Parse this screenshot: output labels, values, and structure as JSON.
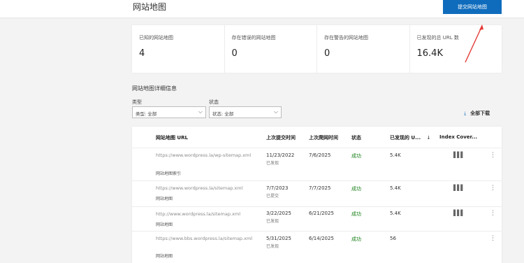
{
  "header": {
    "title": "网站地图",
    "submit_button": "提交网站地图"
  },
  "stats": [
    {
      "label": "已知的网站地图",
      "value": "4"
    },
    {
      "label": "存在错误的网站地图",
      "value": "0"
    },
    {
      "label": "存在警告的网站地图",
      "value": "0"
    },
    {
      "label": "已发现的总 URL 数",
      "value": "16.4K"
    }
  ],
  "details": {
    "title": "网站地图详细信息",
    "type_label": "类型",
    "type_value": "类型: 全部",
    "status_label": "状态",
    "status_value": "状态: 全部",
    "download_label": "全部下载"
  },
  "table": {
    "columns": {
      "url": "网站地图 URL",
      "last_submitted": "上次提交时间",
      "last_crawled": "上次爬网时间",
      "status": "状态",
      "discovered": "已发现的 U...",
      "index_coverage": "Index Cover..."
    },
    "rows": [
      {
        "url": "https://www.wordpress.la/wp-sitemap.xml",
        "type": "网站地图索引",
        "submitted": "11/23/2022",
        "submitted_note": "已发现",
        "crawled": "7/6/2025",
        "status": "成功",
        "discovered": "5.4K"
      },
      {
        "url": "https://www.wordpress.la/sitemap.xml",
        "type": "网站地图",
        "submitted": "7/7/2023",
        "submitted_note": "已提交",
        "crawled": "7/7/2025",
        "status": "成功",
        "discovered": "5.4K"
      },
      {
        "url": "http://www.wordpress.la/sitemap.xml",
        "type": "网站地图",
        "submitted": "3/22/2025",
        "submitted_note": "已发现",
        "crawled": "6/21/2025",
        "status": "成功",
        "discovered": "5.4K"
      },
      {
        "url": "https://www.bbs.wordpress.la/sitemap.xml",
        "type": "网站地图",
        "submitted": "5/31/2025",
        "submitted_note": "已发现",
        "crawled": "6/14/2025",
        "status": "成功",
        "discovered": "56"
      }
    ]
  },
  "icons": {
    "sort": "arrow-down-icon",
    "download": "download-icon",
    "chart": "bar-chart-icon",
    "more": "more-vertical-icon"
  },
  "colors": {
    "accent": "#0f6cbd",
    "success": "#107c10",
    "annotation_arrow": "#e53935"
  }
}
